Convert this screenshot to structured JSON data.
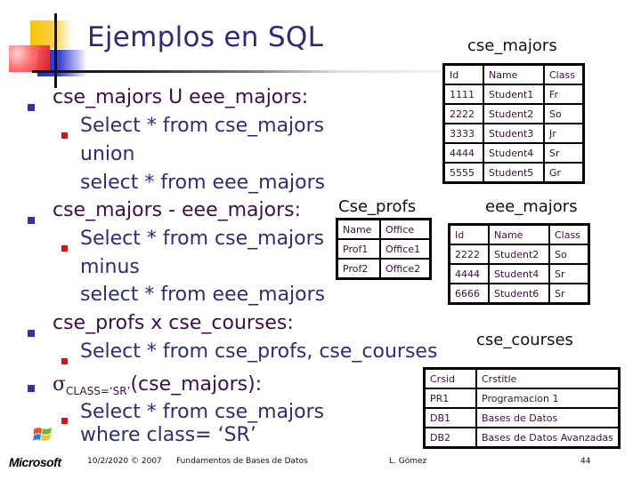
{
  "slide": {
    "title": "Ejemplos en SQL",
    "bullets": [
      {
        "heading": "cse_majors U eee_majors:",
        "sub_lines": [
          "Select * from cse_majors",
          "union",
          "select * from eee_majors"
        ]
      },
      {
        "heading": "cse_majors - eee_majors:",
        "sub_lines": [
          "Select * from cse_majors",
          "minus",
          "select * from eee_majors"
        ]
      },
      {
        "heading": "cse_profs x cse_courses:",
        "sub_lines": [
          "Select * from cse_profs, cse_courses"
        ]
      },
      {
        "sigma": "σ",
        "subscript": "CLASS=‘SR’",
        "heading_rest": "(cse_majors):",
        "sub_lines": [
          "Select * from cse_majors",
          "where class= ‘SR’"
        ]
      }
    ]
  },
  "tables": {
    "cse_majors": {
      "label": "cse_majors",
      "rows": [
        [
          "Id",
          "Name",
          "Class"
        ],
        [
          "1111",
          "Student1",
          "Fr"
        ],
        [
          "2222",
          "Student2",
          "So"
        ],
        [
          "3333",
          "Student3",
          "Jr"
        ],
        [
          "4444",
          "Student4",
          "Sr"
        ],
        [
          "5555",
          "Student5",
          "Gr"
        ]
      ]
    },
    "cse_profs": {
      "label": "Cse_profs",
      "rows": [
        [
          "Name",
          "Office"
        ],
        [
          "Prof1",
          "Office1"
        ],
        [
          "Prof2",
          "Office2"
        ]
      ]
    },
    "eee_majors": {
      "label": "eee_majors",
      "rows": [
        [
          "Id",
          "Name",
          "Class"
        ],
        [
          "2222",
          "Student2",
          "So"
        ],
        [
          "4444",
          "Student4",
          "Sr"
        ],
        [
          "6666",
          "Student6",
          "Sr"
        ]
      ]
    },
    "cse_courses": {
      "label": "cse_courses",
      "rows": [
        [
          "Crsid",
          "Crstitle"
        ],
        [
          "PR1",
          "Programacion 1"
        ],
        [
          "DB1",
          "Bases de Datos"
        ],
        [
          "DB2",
          "Bases de Datos Avanzadas"
        ]
      ]
    }
  },
  "footer": {
    "logo": "Microsoft",
    "date": "10/2/2020 © 2007",
    "course": "Fundamentos de Bases de Datos",
    "author": "L. Gómez",
    "page": "44"
  }
}
